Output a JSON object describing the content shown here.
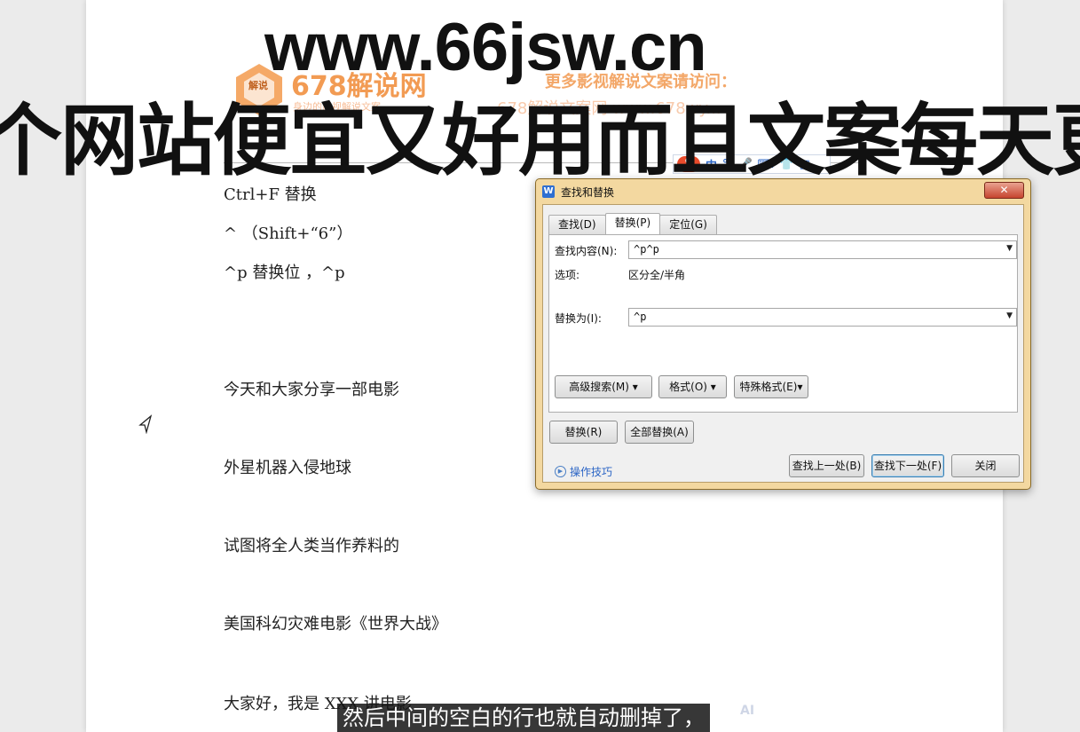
{
  "overlay": {
    "url": "www.66jsw.cn",
    "banner": "个网站便宜又好用而且文案每天更"
  },
  "watermark": {
    "logo_label": "解说",
    "brand": "678解说网",
    "sub": "身边的影视解说文案",
    "promo_line1": "更多影视解说文案请访问：",
    "promo_line2": "678解说文案网 www.678wy..."
  },
  "ime_bar": {
    "logo": "S",
    "items": [
      "中",
      "°,",
      "🎤",
      "⌨",
      "👕",
      "▦"
    ]
  },
  "document": {
    "lines": [
      "Ctrl+F 替换",
      "^   （Shift+“6”）",
      "^p  替换位  ，^p",
      "今天和大家分享一部电影",
      "外星机器入侵地球",
      "试图将全人类当作养料的",
      "美国科幻灾难电影《世界大战》",
      "大家好，我是 XXX 讲电影"
    ]
  },
  "dialog": {
    "title": "查找和替换",
    "close_label": "✕",
    "tabs": [
      "查找(D)",
      "替换(P)",
      "定位(G)"
    ],
    "active_tab": "替换(P)",
    "find_label": "查找内容(N):",
    "find_value": "^p^p",
    "options_label": "选项:",
    "options_value": "区分全/半角",
    "replace_label": "替换为(I):",
    "replace_value": "^p",
    "btn_advanced": "高级搜索(M) ▾",
    "btn_format": "格式(O) ▾",
    "btn_special": "特殊格式(E)▾",
    "btn_replace": "替换(R)",
    "btn_replace_all": "全部替换(A)",
    "tips": "操作技巧",
    "btn_find_prev": "查找上一处(B)",
    "btn_find_next": "查找下一处(F)",
    "btn_close": "关闭"
  },
  "subtitle": {
    "text": "然后中间的空白的行也就自动删掉了，",
    "ai_mark": "AI"
  }
}
